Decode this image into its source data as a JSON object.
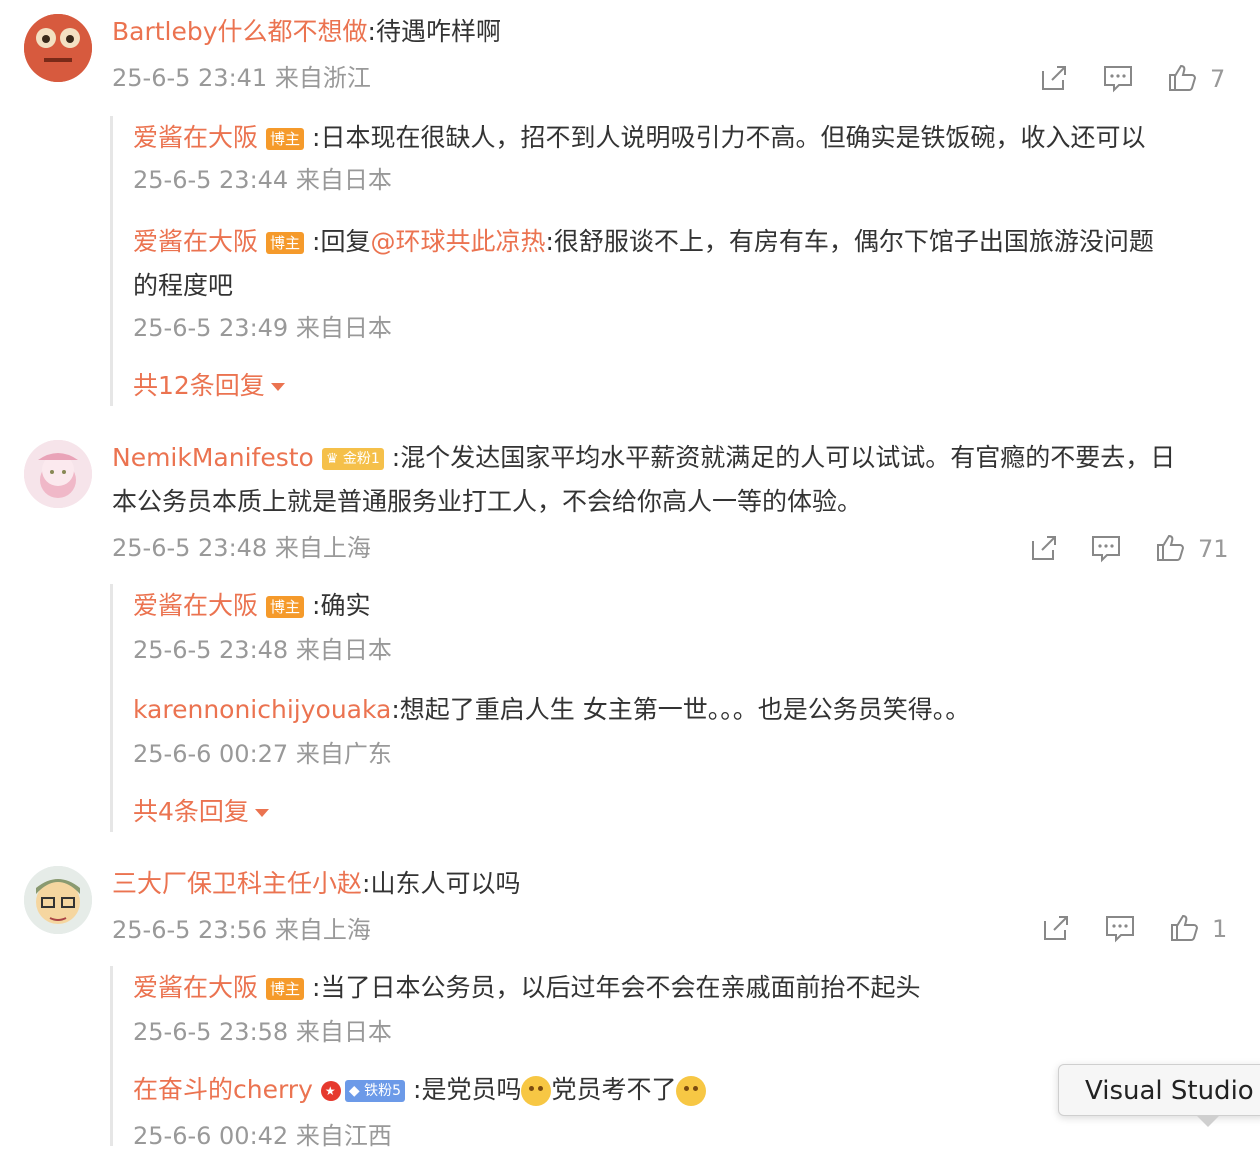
{
  "colors": {
    "username": "#eb7350",
    "meta": "#999999",
    "host_badge": "#f59a2b"
  },
  "comments": [
    {
      "username": "Bartleby什么都不想做",
      "text": ":待遇咋样啊",
      "meta": "25-6-5 23:41 来自浙江",
      "likes": "7",
      "replies": [
        {
          "username": "爱酱在大阪",
          "badge": "博主",
          "text": ":日本现在很缺人，招不到人说明吸引力不高。但确实是铁饭碗，收入还可以",
          "meta": "25-6-5 23:44 来自日本"
        },
        {
          "username": "爱酱在大阪",
          "badge": "博主",
          "text_prefix": ":回复",
          "mention": "@环球共此凉热",
          "text": ":很舒服谈不上，有房有车，偶尔下馆子出国旅游没问题",
          "text_line2": "的程度吧",
          "meta": "25-6-5 23:49 来自日本"
        }
      ],
      "more_replies": "共12条回复"
    },
    {
      "username": "NemikManifesto",
      "badge": "金粉1",
      "text": ":混个发达国家平均水平薪资就满足的人可以试试。有官瘾的不要去，日",
      "text_line2": "本公务员本质上就是普通服务业打工人，不会给你高人一等的体验。",
      "meta": "25-6-5 23:48 来自上海",
      "likes": "71",
      "replies": [
        {
          "username": "爱酱在大阪",
          "badge": "博主",
          "text": ":确实",
          "meta": "25-6-5 23:48 来自日本"
        },
        {
          "username": "karennonichijyouaka",
          "text": ":想起了重启人生 女主第一世。。。也是公务员笑得。。",
          "meta": "25-6-6 00:27 来自广东"
        }
      ],
      "more_replies": "共4条回复"
    },
    {
      "username": "三大厂保卫科主任小赵",
      "text": ":山东人可以吗",
      "meta": "25-6-5 23:56 来自上海",
      "likes": "1",
      "replies": [
        {
          "username": "爱酱在大阪",
          "badge": "博主",
          "text": ":当了日本公务员，以后过年会不会在亲戚面前抬不起头",
          "meta": "25-6-5 23:58 来自日本"
        },
        {
          "username": "在奋斗的cherry",
          "badge": "铁粉5",
          "text": ":是党员吗",
          "text_mid": "党员考不了",
          "meta": "25-6-6 00:42 来自江西"
        }
      ]
    }
  ],
  "tooltip": "Visual Studio"
}
